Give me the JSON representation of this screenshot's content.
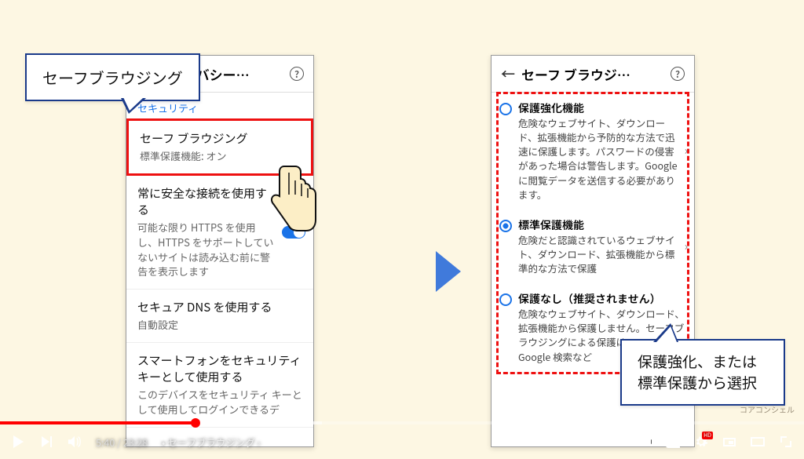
{
  "callouts": {
    "c1": "セーフブラウジング",
    "c2": "保護強化、または標準保護から選択"
  },
  "leftPhone": {
    "header_title": "プライバシー…",
    "section_label": "セキュリティ",
    "safe_browsing_title": "セーフ ブラウジング",
    "safe_browsing_sub": "標準保護機能: オン",
    "https_title": "常に安全な接続を使用する",
    "https_sub": "可能な限り HTTPS を使用し、HTTPS をサポートしていないサイトは読み込む前に警告を表示します",
    "dns_title": "セキュア DNS を使用する",
    "dns_sub": "自動設定",
    "key_title": "スマートフォンをセキュリティキーとして使用する",
    "key_sub": "このデバイスをセキュリティ キーとして使用してログインできるデ"
  },
  "rightPhone": {
    "header_title": "セーフ ブラウジ…",
    "enhanced_title": "保護強化機能",
    "enhanced_desc": "危険なウェブサイト、ダウンロード、拡張機能から予防的な方法で迅速に保護します。パスワードの侵害があった場合は警告します。Google に閲覧データを送信する必要があります。",
    "standard_title": "標準保護機能",
    "standard_desc": "危険だと認識されているウェブサイト、ダウンロード、拡張機能から標準的な方法で保護",
    "none_title": "保護なし（推奨されません）",
    "none_desc": "危険なウェブサイト、ダウンロード、拡張機能から保護しません。セーフブラウジングによる保護は、Gmail や Google 検索など"
  },
  "player": {
    "time_current": "5:40",
    "time_total": "23:28",
    "chapter": "セーフブラウジング",
    "hd": "HD"
  },
  "watermark": "コアコンシェル"
}
